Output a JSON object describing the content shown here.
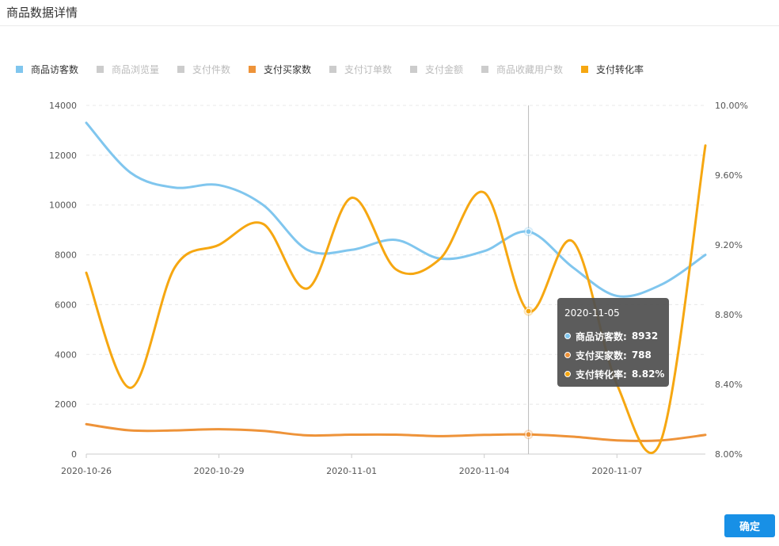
{
  "header": {
    "title": "商品数据详情"
  },
  "footer": {
    "confirm_label": "确定"
  },
  "tooltip": {
    "date": "2020-11-05",
    "rows": [
      {
        "label": "商品访客数:",
        "value": "8932",
        "color": "#80c6ee"
      },
      {
        "label": "支付买家数:",
        "value": "788",
        "color": "#ee9339"
      },
      {
        "label": "支付转化率:",
        "value": "8.82%",
        "color": "#f6a711"
      }
    ]
  },
  "chart_data": {
    "type": "line",
    "legend": [
      {
        "name": "商品访客数",
        "color": "#80c6ee",
        "active": true
      },
      {
        "name": "商品浏览量",
        "color": "#cccccc",
        "active": false
      },
      {
        "name": "支付件数",
        "color": "#cccccc",
        "active": false
      },
      {
        "name": "支付买家数",
        "color": "#ee9339",
        "active": true
      },
      {
        "name": "支付订单数",
        "color": "#cccccc",
        "active": false
      },
      {
        "name": "支付金额",
        "color": "#cccccc",
        "active": false
      },
      {
        "name": "商品收藏用户数",
        "color": "#cccccc",
        "active": false
      },
      {
        "name": "支付转化率",
        "color": "#f6a711",
        "active": true
      }
    ],
    "x": [
      "2020-10-26",
      "2020-10-27",
      "2020-10-28",
      "2020-10-29",
      "2020-10-30",
      "2020-10-31",
      "2020-11-01",
      "2020-11-02",
      "2020-11-03",
      "2020-11-04",
      "2020-11-05",
      "2020-11-06",
      "2020-11-07",
      "2020-11-08",
      "2020-11-09"
    ],
    "x_tick_labels": [
      "2020-10-26",
      "2020-10-29",
      "2020-11-01",
      "2020-11-04",
      "2020-11-07"
    ],
    "y_left": {
      "min": 0,
      "max": 14000,
      "ticks": [
        "0",
        "2000",
        "4000",
        "6000",
        "8000",
        "10000",
        "12000",
        "14000"
      ]
    },
    "y_right": {
      "min": 8.0,
      "max": 10.0,
      "ticks": [
        "8.00%",
        "8.40%",
        "8.80%",
        "9.20%",
        "9.60%",
        "10.00%"
      ]
    },
    "series": [
      {
        "name": "商品访客数",
        "axis": "left",
        "color": "#80c6ee",
        "values": [
          13300,
          11300,
          10700,
          10800,
          10000,
          8200,
          8200,
          8600,
          7850,
          8150,
          8932,
          7500,
          6350,
          6800,
          8000
        ]
      },
      {
        "name": "支付买家数",
        "axis": "left",
        "color": "#ee9339",
        "values": [
          1200,
          950,
          950,
          1000,
          930,
          750,
          780,
          780,
          720,
          770,
          788,
          700,
          550,
          550,
          770
        ]
      },
      {
        "name": "支付转化率",
        "axis": "right",
        "color": "#f6a711",
        "values": [
          9.04,
          8.38,
          9.07,
          9.2,
          9.32,
          8.95,
          9.47,
          9.06,
          9.12,
          9.5,
          8.82,
          9.22,
          8.4,
          8.08,
          9.77
        ]
      }
    ],
    "highlight_x": "2020-11-05",
    "grid": true
  }
}
